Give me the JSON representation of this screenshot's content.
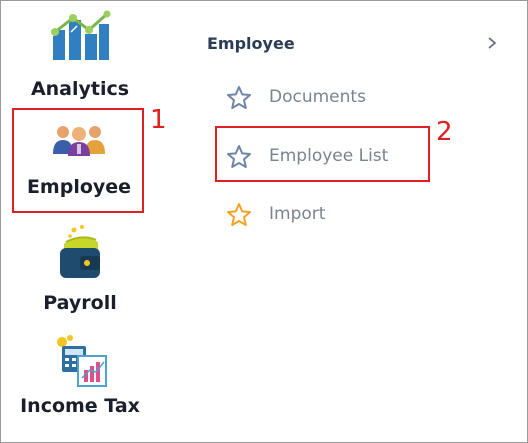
{
  "sidebar": {
    "items": [
      {
        "label": "Analytics",
        "icon": "analytics-icon"
      },
      {
        "label": "Employee",
        "icon": "employee-group-icon"
      },
      {
        "label": "Payroll",
        "icon": "wallet-icon"
      },
      {
        "label": "Income Tax",
        "icon": "tax-calculator-icon"
      }
    ]
  },
  "submenu": {
    "title": "Employee",
    "items": [
      {
        "label": "Documents",
        "icon": "star-outline-icon",
        "color": "#6f85a6"
      },
      {
        "label": "Employee List",
        "icon": "star-outline-icon",
        "color": "#6f85a6"
      },
      {
        "label": "Import",
        "icon": "star-outline-icon",
        "color": "#f2a322"
      }
    ]
  },
  "annotations": [
    {
      "number": "1",
      "target": "Employee"
    },
    {
      "number": "2",
      "target": "Employee List"
    }
  ],
  "colors": {
    "annotation": "#e0201f",
    "nav_text": "#1a1f2b",
    "submenu_text": "#7a8391"
  }
}
